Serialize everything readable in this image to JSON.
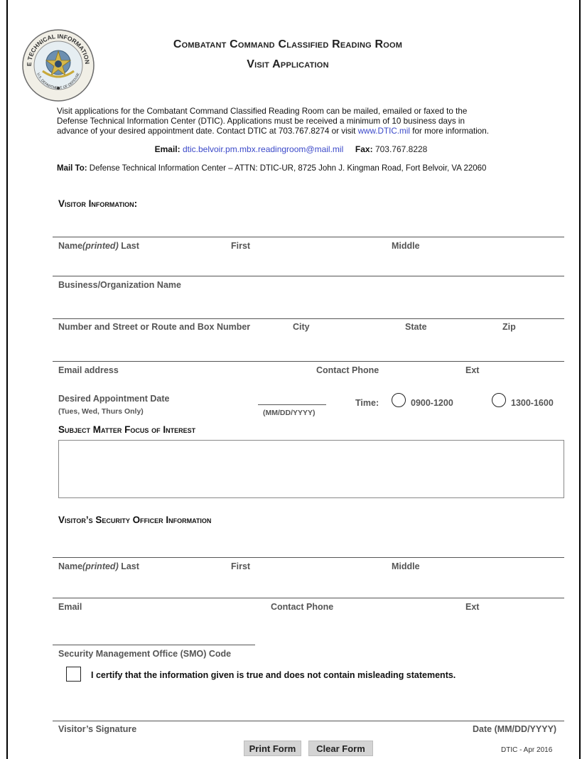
{
  "header": {
    "title_line1": "Combatant Command Classified Reading Room",
    "title_line2": "Visit Application",
    "seal_text_top": "DEFENSE TECHNICAL INFORMATION CENTER",
    "seal_text_bottom": "U.S. DEPARTMENT OF DEFENSE"
  },
  "intro": {
    "line1": "Visit applications for the Combatant Command Classified Reading Room can be mailed, emailed or faxed to the",
    "line2": "Defense Technical Information Center (DTIC).  Applications must be received a minimum of 10 business days in",
    "line3_pre": "advance of your desired appointment date. Contact DTIC at 703.767.8274 or visit ",
    "line3_link": "www.DTIC.mil",
    "line3_post": " for more information."
  },
  "contact": {
    "email_label": "Email:",
    "email_value": "dtic.belvoir.pm.mbx.readingroom@mail.mil",
    "fax_label": "Fax:",
    "fax_value": "703.767.8228",
    "mail_label": "Mail To:",
    "mail_value": "Defense Technical Information Center – ATTN: DTIC-UR, 8725 John J. Kingman Road, Fort Belvoir, VA 22060"
  },
  "visitor": {
    "heading": "Visitor Information:",
    "name_label_pre": "Name",
    "name_label_italic": "(printed)",
    "name_label_post": " Last",
    "first_label": "First",
    "middle_label": "Middle",
    "org_label": "Business/Organization Name",
    "street_label": "Number and Street or Route and Box Number",
    "city_label": "City",
    "state_label": "State",
    "zip_label": "Zip",
    "email_label": "Email address",
    "phone_label": "Contact Phone",
    "ext_label": "Ext",
    "appt_label": "Desired Appointment Date",
    "appt_note": "(Tues, Wed, Thurs Only)",
    "date_format": "(MM/DD/YYYY)",
    "time_label": "Time:",
    "time_option1": "0900-1200",
    "time_option2": "1300-1600"
  },
  "subject": {
    "heading": "Subject Matter Focus of Interest"
  },
  "security": {
    "heading": "Visitor’s Security Officer Information",
    "name_label_pre": "Name",
    "name_label_italic": "(printed)",
    "name_label_post": " Last",
    "first_label": "First",
    "middle_label": "Middle",
    "email_label": "Email",
    "phone_label": "Contact Phone",
    "ext_label": "Ext",
    "smo_label": "Security Management Office (SMO) Code"
  },
  "certify": {
    "text": "I certify that the information given is true and does not contain misleading statements."
  },
  "signature": {
    "signature_label": "Visitor’s Signature",
    "date_label": "Date (MM/DD/YYYY)"
  },
  "buttons": {
    "print_label": "Print Form",
    "clear_label": "Clear Form"
  },
  "footer": {
    "note": "DTIC - Apr 2016"
  }
}
